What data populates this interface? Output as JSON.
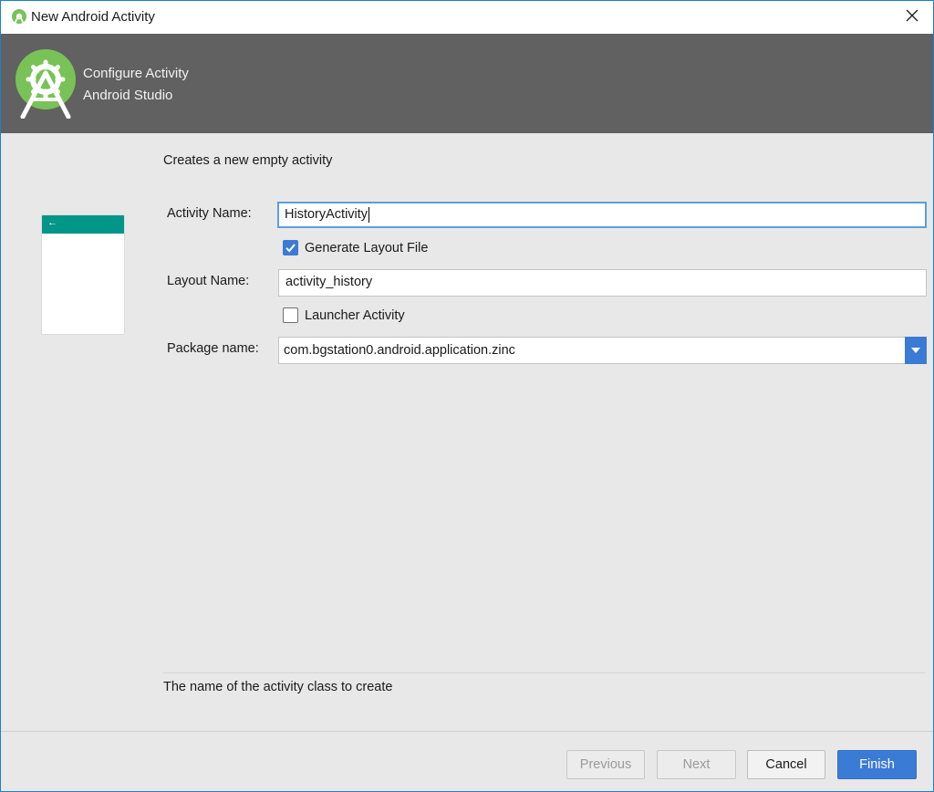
{
  "window": {
    "title": "New Android Activity"
  },
  "header": {
    "title": "Configure Activity",
    "subtitle": "Android Studio"
  },
  "content": {
    "description": "Creates a new empty activity",
    "preview_arrow": "←",
    "fields": {
      "activity_name_label": "Activity Name:",
      "activity_name_value": "HistoryActivity",
      "generate_layout_label": "Generate Layout File",
      "generate_layout_checked": true,
      "layout_name_label": "Layout Name:",
      "layout_name_value": "activity_history",
      "launcher_activity_label": "Launcher Activity",
      "launcher_activity_checked": false,
      "package_name_label": "Package name:",
      "package_name_value": "com.bgstation0.android.application.zinc"
    },
    "hint": "The name of the activity class to create"
  },
  "footer": {
    "previous_label": "Previous",
    "next_label": "Next",
    "cancel_label": "Cancel",
    "finish_label": "Finish"
  },
  "colors": {
    "header_bg": "#616161",
    "accent": "#3a7bd5",
    "preview_bar": "#009688",
    "logo_green": "#78c257"
  },
  "icons": {
    "title": "android-studio-icon",
    "header": "android-studio-logo",
    "close": "close-icon",
    "dropdown": "dropdown-arrow-icon",
    "check": "checkmark-icon"
  }
}
